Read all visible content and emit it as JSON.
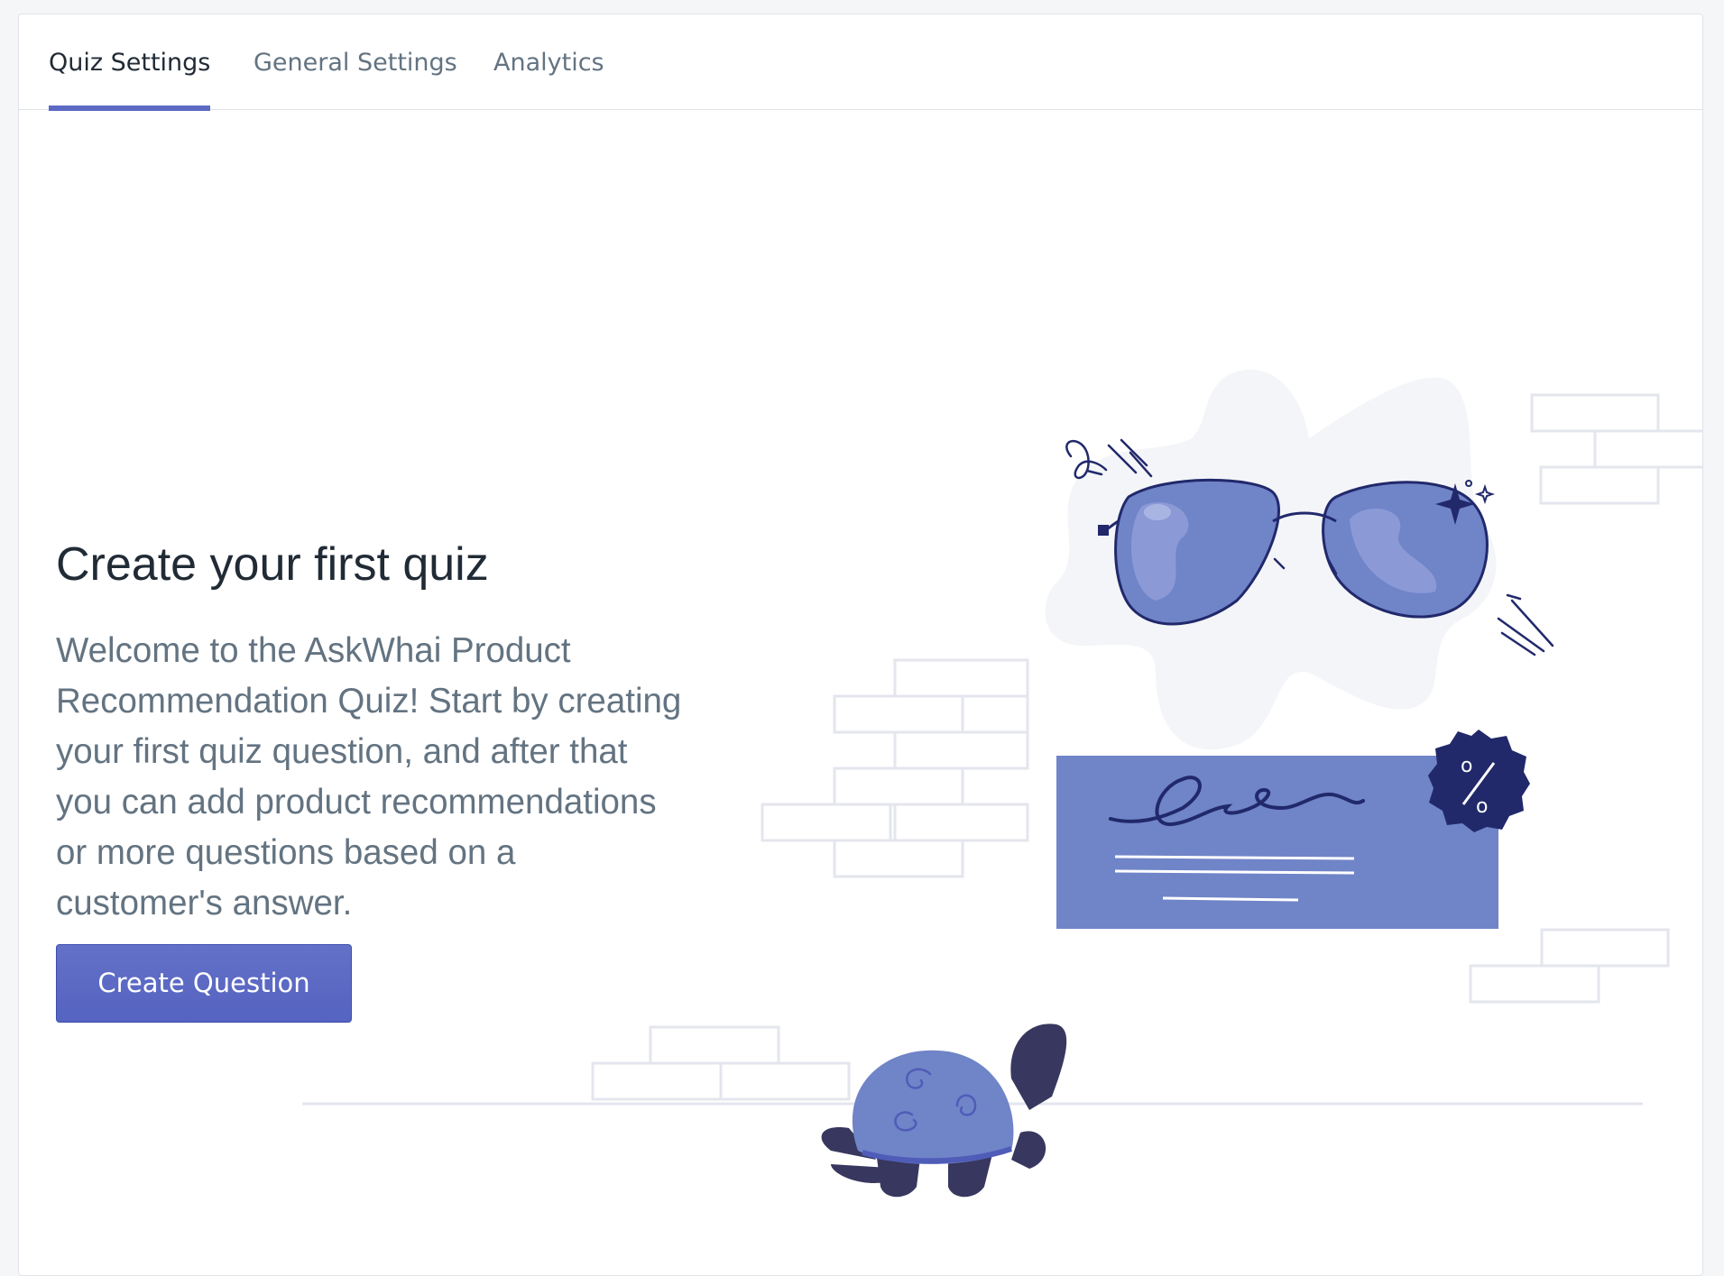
{
  "tabs": [
    {
      "label": "Quiz Settings",
      "active": true
    },
    {
      "label": "General Settings",
      "active": false
    },
    {
      "label": "Analytics",
      "active": false
    }
  ],
  "empty_state": {
    "heading": "Create your first quiz",
    "body": "Welcome to the AskWhai Product Recommendation Quiz! Start by creating your first quiz question, and after that you can add product recommendations or more questions based on a customer's answer.",
    "primary_action": "Create Question"
  },
  "illustration": {
    "objects": [
      "sunglasses-icon",
      "coupon-card-icon",
      "percent-badge-icon",
      "turtle-icon",
      "brick-wall-icon"
    ]
  },
  "colors": {
    "accent": "#5c6ac4",
    "illustration_purple": "#7084c8",
    "illustration_navy": "#21296b",
    "text_primary": "#212b36",
    "text_subdued": "#637381",
    "border": "#dfe3e8"
  }
}
